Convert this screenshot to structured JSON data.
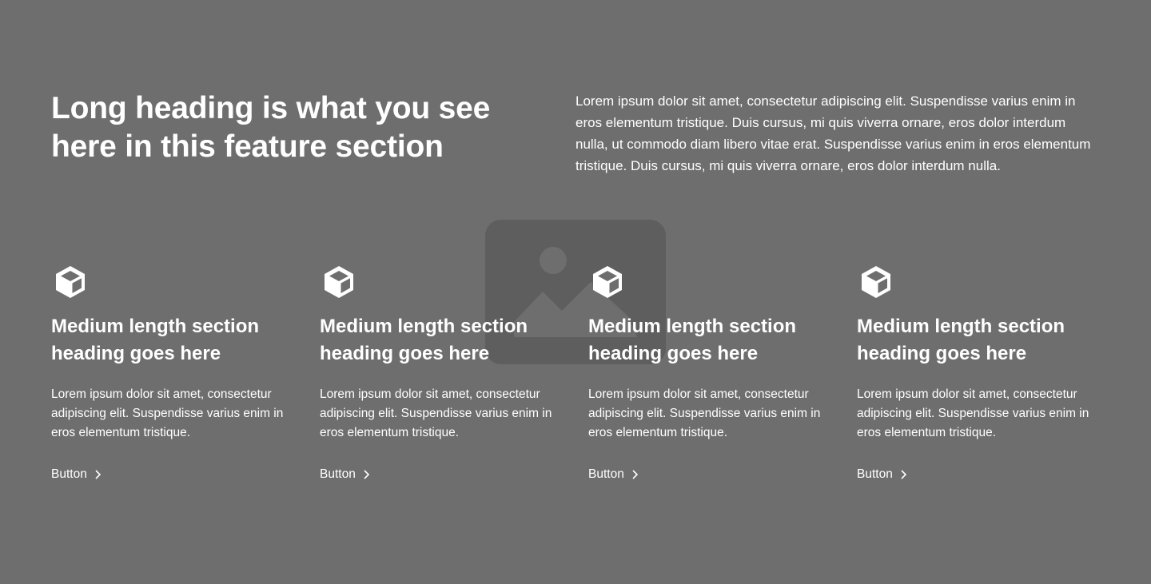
{
  "heading": "Long heading is what you see here in this feature section",
  "intro": "Lorem ipsum dolor sit amet, consectetur adipiscing elit. Suspendisse varius enim in eros elementum tristique. Duis cursus, mi quis viverra ornare, eros dolor interdum nulla, ut commodo diam libero vitae erat. Suspendisse varius enim in eros elementum tristique. Duis cursus, mi quis viverra ornare, eros dolor interdum nulla.",
  "features": [
    {
      "icon": "cube-icon",
      "title": "Medium length section heading goes here",
      "text": "Lorem ipsum dolor sit amet, consectetur adipiscing elit. Suspendisse varius enim in eros elementum tristique.",
      "button": "Button"
    },
    {
      "icon": "cube-icon",
      "title": "Medium length section heading goes here",
      "text": "Lorem ipsum dolor sit amet, consectetur adipiscing elit. Suspendisse varius enim in eros elementum tristique.",
      "button": "Button"
    },
    {
      "icon": "cube-icon",
      "title": "Medium length section heading goes here",
      "text": "Lorem ipsum dolor sit amet, consectetur adipiscing elit. Suspendisse varius enim in eros elementum tristique.",
      "button": "Button"
    },
    {
      "icon": "cube-icon",
      "title": "Medium length section heading goes here",
      "text": "Lorem ipsum dolor sit amet, consectetur adipiscing elit. Suspendisse varius enim in eros elementum tristique.",
      "button": "Button"
    }
  ],
  "colors": {
    "background": "#6e6e6e",
    "text": "#ffffff",
    "placeholder": "#5e5e5e"
  }
}
